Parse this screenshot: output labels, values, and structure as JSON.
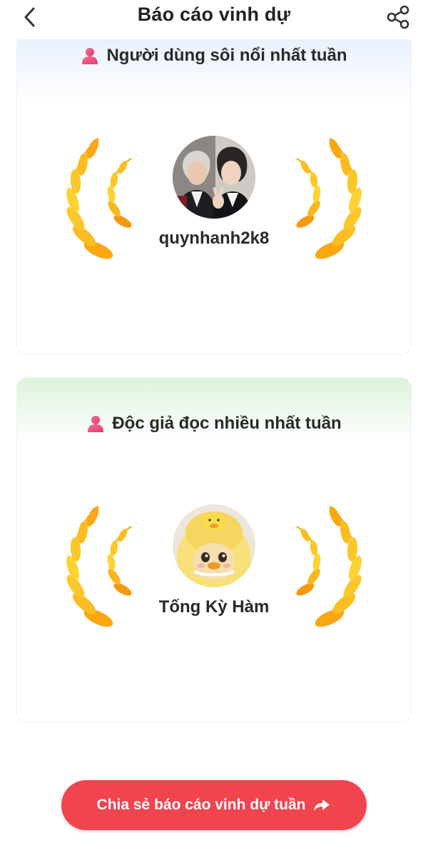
{
  "header": {
    "title": "Báo cáo vinh dự",
    "back_icon": "chevron-left-icon",
    "share_icon": "share-nodes-icon"
  },
  "cards": [
    {
      "heading": "Người dùng sôi nổi nhất tuần",
      "icon": "person-icon",
      "username": "quynhanh2k8",
      "accent": "#e9f1fd"
    },
    {
      "heading": "Độc giả đọc nhiều nhất tuần",
      "icon": "person-icon",
      "username": "Tống Kỳ Hàm",
      "accent": "#dcf3dc"
    }
  ],
  "share_button": {
    "label": "Chia sẻ báo cáo vinh dự tuần",
    "icon": "forward-arrow-icon",
    "color": "#f0444f"
  },
  "colors": {
    "laurel_light": "#ffd23a",
    "laurel_dark": "#f59a10",
    "person_icon": "#ee4b7a"
  }
}
